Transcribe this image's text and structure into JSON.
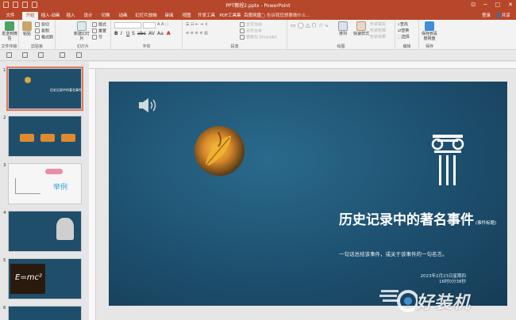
{
  "window": {
    "title": "PPT教程2.pptx - PowerPoint",
    "controls": [
      "─",
      "□",
      "✕"
    ],
    "ribbon_collapse": "⊡"
  },
  "tabs": [
    {
      "label": "文件"
    },
    {
      "label": "开始"
    },
    {
      "label": "插入·动画"
    },
    {
      "label": "插入"
    },
    {
      "label": "设计"
    },
    {
      "label": "切换"
    },
    {
      "label": "动画"
    },
    {
      "label": "幻灯片放映"
    },
    {
      "label": "审阅"
    },
    {
      "label": "视图"
    },
    {
      "label": "开发工具"
    },
    {
      "label": "PDF工具集"
    },
    {
      "label": "百度网盘"
    }
  ],
  "tell_me": "告诉我您想要做什么...",
  "account": {
    "login": "登录",
    "share": "共享"
  },
  "ribbon": {
    "groups": [
      {
        "name": "文件传输",
        "items": [
          "发送到微信"
        ]
      },
      {
        "name": "剪贴板",
        "items": [
          "粘贴",
          "剪切",
          "复制",
          "格式刷"
        ]
      },
      {
        "name": "幻灯片",
        "items": [
          "新建幻灯片",
          "版式",
          "重置",
          "节"
        ]
      },
      {
        "name": "字体",
        "items": [
          "B",
          "I",
          "U",
          "S",
          "abc",
          "AV",
          "Aa",
          "A"
        ]
      },
      {
        "name": "段落",
        "items": [
          "文字方向",
          "对齐文本",
          "转换为 SmartArt"
        ]
      },
      {
        "name": "绘图",
        "items": [
          "排列",
          "快速样式",
          "形状填充",
          "形状轮廓",
          "形状效果"
        ]
      },
      {
        "name": "编辑",
        "items": [
          "查找",
          "替换",
          "选择"
        ]
      },
      {
        "name": "保存",
        "items": [
          "保存到百度网盘"
        ]
      }
    ]
  },
  "slides_panel": {
    "slides": [
      {
        "num": "1",
        "title": "历史记录中的著名事件"
      },
      {
        "num": "2",
        "title": ""
      },
      {
        "num": "3",
        "title": "举例"
      },
      {
        "num": "4",
        "title": ""
      },
      {
        "num": "5",
        "title": "E=mc²"
      },
      {
        "num": "6",
        "title": ""
      }
    ]
  },
  "slide": {
    "title": "历史记录中的著名事件",
    "tag": "(事件标题)",
    "subtitle": "一句话总结该事件，或关于该事件的一句名言。",
    "date_line1": "2023年2月23日星期四",
    "date_line2": "16时0分38秒"
  },
  "watermark": {
    "text": "好装机"
  },
  "colors": {
    "accent": "#b7472a",
    "slide_bg": "#1d4f6e",
    "selection": "#e07a5f"
  }
}
